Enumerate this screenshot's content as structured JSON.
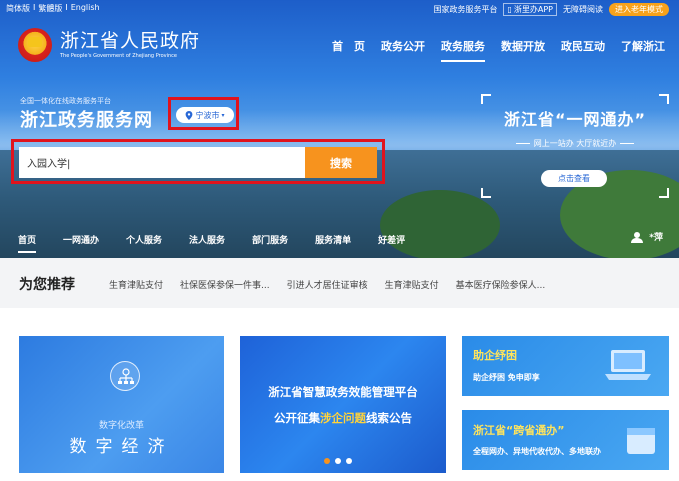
{
  "top": {
    "lang": [
      "简体版",
      "繁體版",
      "English"
    ],
    "lang_sep": "I",
    "gov_portal": "国家政务服务平台",
    "app": "浙里办APP",
    "accessible": "无障碍阅读",
    "elder_mode": "进入老年模式"
  },
  "logo": {
    "cn": "浙江省人民政府",
    "en": "The People's Government of Zhejiang Province"
  },
  "mainnav": [
    "首　页",
    "政务公开",
    "政务服务",
    "数据开放",
    "政民互动",
    "了解浙江"
  ],
  "service": {
    "subtitle": "全国一体化在线政务服务平台",
    "title": "浙江政务服务网",
    "city": "宁波市"
  },
  "search": {
    "value": "入园入学|",
    "button": "搜索"
  },
  "promo": {
    "title": "浙江省“一网通办”",
    "subtitle": "网上一站办 大厅就近办",
    "button": "点击查看"
  },
  "secnav": [
    "首页",
    "一网通办",
    "个人服务",
    "法人服务",
    "部门服务",
    "服务清单",
    "好差评"
  ],
  "user": {
    "name": "*萍"
  },
  "recommend": {
    "title": "为您推荐",
    "items": [
      "生育津贴支付",
      "社保医保参保一件事...",
      "引进人才居住证审核",
      "生育津贴支付",
      "基本医疗保险参保人..."
    ]
  },
  "cards": {
    "digital": {
      "cn": "数字化改革",
      "big": "数字经济"
    },
    "notice": {
      "line1": "浙江省智慧政务效能管理平台",
      "line2_a": "公开征集",
      "line2_hl": "涉企问题",
      "line2_b": "线索公告"
    },
    "enterprise": {
      "title": "助企纾困",
      "sub": "助企纾困 免申即享"
    },
    "cross": {
      "title": "浙江省“跨省通办”",
      "sub": "全程网办、异地代收代办、多地联办"
    }
  },
  "colors": {
    "brand_blue": "#2968d6",
    "accent_orange": "#f7931e",
    "highlight_red": "#e0131d"
  }
}
